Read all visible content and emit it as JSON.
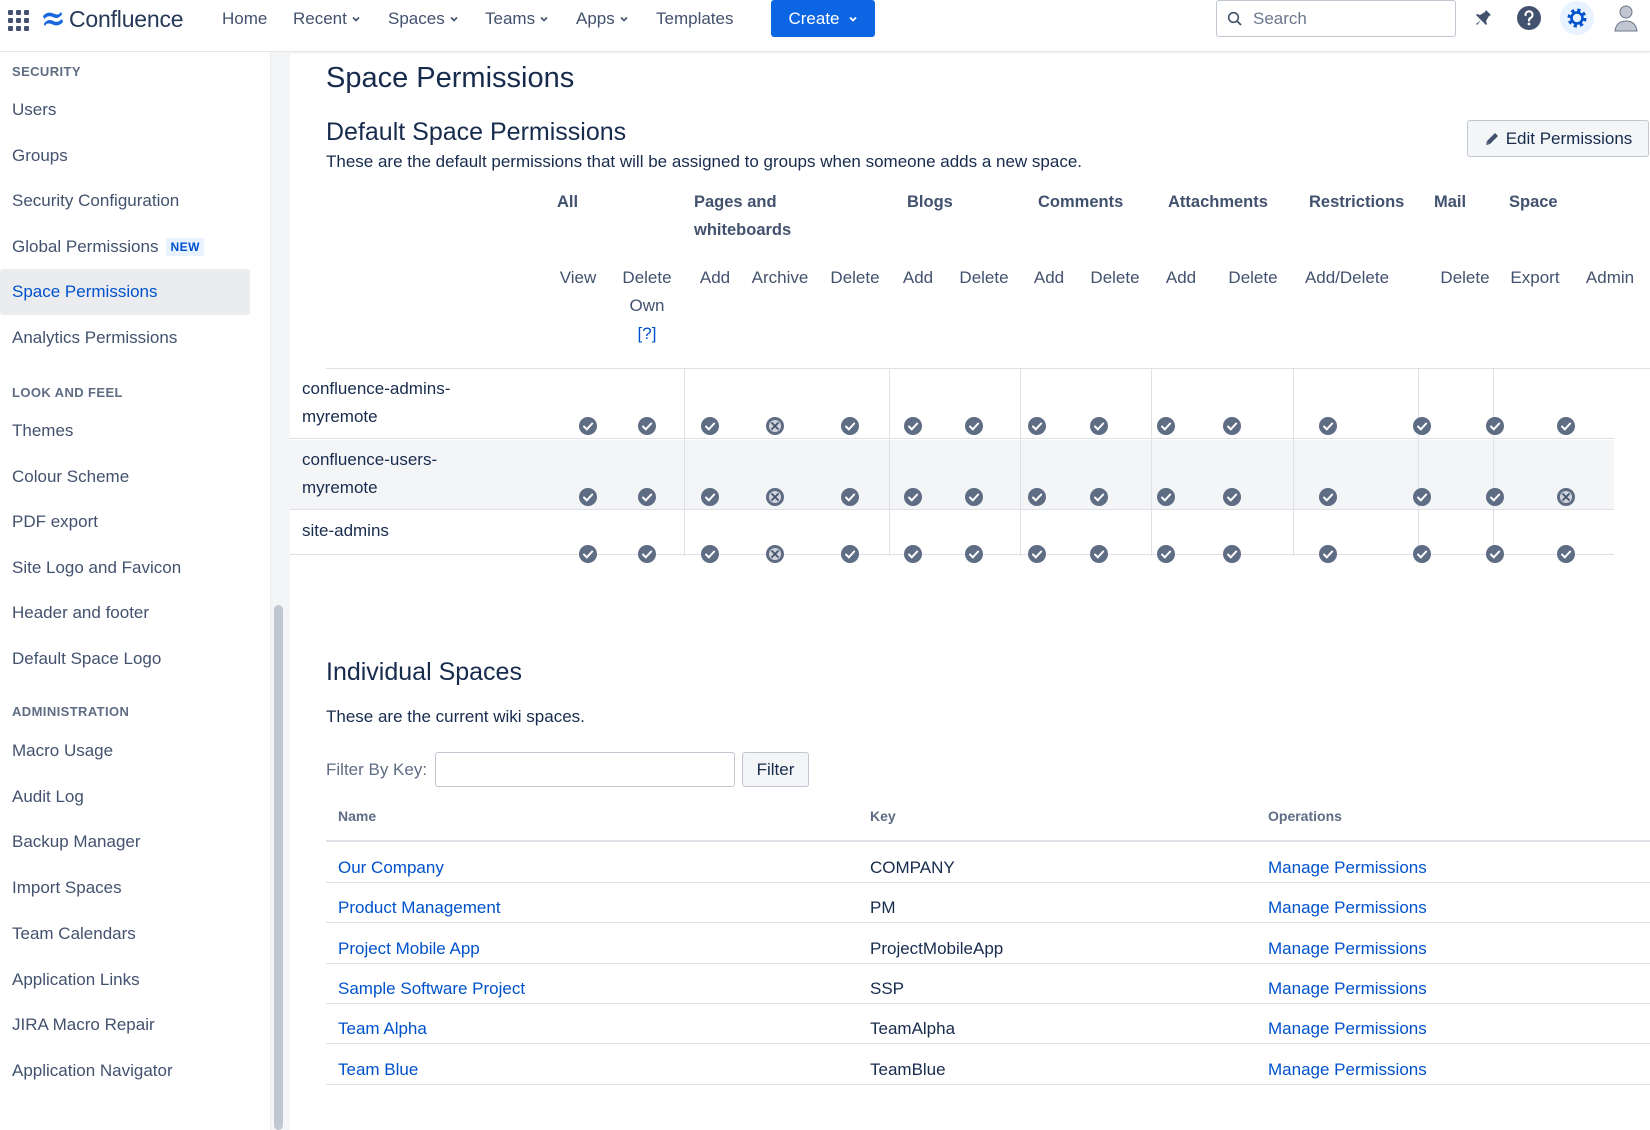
{
  "topnav": {
    "app_name": "Confluence",
    "items": [
      {
        "label": "Home",
        "has_dropdown": false
      },
      {
        "label": "Recent",
        "has_dropdown": true
      },
      {
        "label": "Spaces",
        "has_dropdown": true
      },
      {
        "label": "Teams",
        "has_dropdown": true
      },
      {
        "label": "Apps",
        "has_dropdown": true
      },
      {
        "label": "Templates",
        "has_dropdown": false
      }
    ],
    "create_label": "Create",
    "search_placeholder": "Search",
    "icons": [
      "notifications-icon",
      "help-icon",
      "settings-icon",
      "profile-avatar-icon"
    ],
    "accent_color": "#0c66e4"
  },
  "sidebar": {
    "sections": [
      {
        "heading": "SECURITY",
        "items": [
          "Users",
          "Groups",
          "Security Configuration",
          "Global Permissions",
          "Space Permissions",
          "Analytics Permissions"
        ]
      },
      {
        "heading": "LOOK AND FEEL",
        "items": [
          "Themes",
          "Colour Scheme",
          "PDF export",
          "Site Logo and Favicon",
          "Header and footer",
          "Default Space Logo"
        ]
      },
      {
        "heading": "ADMINISTRATION",
        "items": [
          "Macro Usage",
          "Audit Log",
          "Backup Manager",
          "Import Spaces",
          "Team Calendars",
          "Application Links",
          "JIRA Macro Repair",
          "Application Navigator"
        ]
      }
    ],
    "new_badge": "NEW",
    "active_item": "Space Permissions"
  },
  "main": {
    "page_title": "Space Permissions",
    "default_section": {
      "title": "Default Space Permissions",
      "description": "These are the default permissions that will be assigned to groups when someone adds a new space.",
      "edit_button": "Edit Permissions",
      "categories": [
        "All",
        "Pages and",
        "whiteboards",
        "Blogs",
        "Comments",
        "Attachments",
        "Restrictions",
        "Mail",
        "Space"
      ],
      "columns": [
        "View",
        "Delete",
        "Own",
        "[?]",
        "Add",
        "Archive",
        "Delete",
        "Add",
        "Delete",
        "Add",
        "Delete",
        "Add",
        "Delete",
        "Add/Delete",
        "Delete",
        "Export",
        "Admin"
      ],
      "groups": [
        {
          "name_line1": "confluence-admins-",
          "name_line2": "myremote",
          "perms": [
            true,
            true,
            true,
            false,
            true,
            true,
            true,
            true,
            true,
            true,
            true,
            true,
            true,
            true,
            true
          ]
        },
        {
          "name_line1": "confluence-users-",
          "name_line2": "myremote",
          "perms": [
            true,
            true,
            true,
            false,
            true,
            true,
            true,
            true,
            true,
            true,
            true,
            true,
            true,
            true,
            false
          ]
        },
        {
          "name_line1": "site-admins",
          "name_line2": "",
          "perms": [
            true,
            true,
            true,
            false,
            true,
            true,
            true,
            true,
            true,
            true,
            true,
            true,
            true,
            true,
            true
          ]
        }
      ],
      "granted_color": "#5e6c84",
      "denied_color": "#5e6c84"
    },
    "individual_section": {
      "title": "Individual Spaces",
      "description": "These are the current wiki spaces.",
      "filter_label": "Filter By Key:",
      "filter_value": "",
      "filter_button": "Filter",
      "headers": {
        "name": "Name",
        "key": "Key",
        "operations": "Operations"
      },
      "rows": [
        {
          "name": "Our Company",
          "key": "COMPANY",
          "operation": "Manage Permissions"
        },
        {
          "name": "Product Management",
          "key": "PM",
          "operation": "Manage Permissions"
        },
        {
          "name": "Project Mobile App",
          "key": "ProjectMobileApp",
          "operation": "Manage Permissions"
        },
        {
          "name": "Sample Software Project",
          "key": "SSP",
          "operation": "Manage Permissions"
        },
        {
          "name": "Team Alpha",
          "key": "TeamAlpha",
          "operation": "Manage Permissions"
        },
        {
          "name": "Team Blue",
          "key": "TeamBlue",
          "operation": "Manage Permissions"
        }
      ]
    }
  }
}
